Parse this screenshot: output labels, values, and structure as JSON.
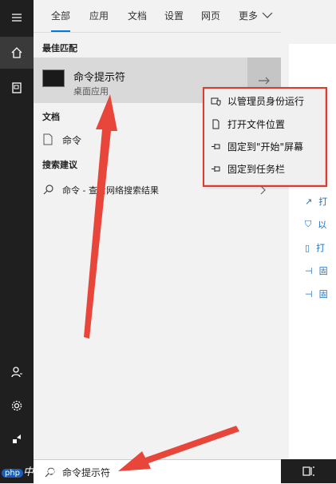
{
  "tabs": [
    "全部",
    "应用",
    "文档",
    "设置",
    "网页",
    "更多"
  ],
  "best_match": {
    "heading": "最佳匹配",
    "title": "命令提示符",
    "subtitle": "桌面应用"
  },
  "documents": {
    "heading": "文档",
    "item": "命令"
  },
  "search_suggestions": {
    "heading": "搜索建议",
    "item": "命令 - 查看网络搜索结果"
  },
  "context_menu": [
    {
      "label": "以管理员身份运行",
      "icon": "shield-icon"
    },
    {
      "label": "打开文件位置",
      "icon": "file-icon"
    },
    {
      "label": "固定到\"开始\"屏幕",
      "icon": "pin-icon"
    },
    {
      "label": "固定到任务栏",
      "icon": "pin-icon"
    }
  ],
  "right_actions": [
    "打",
    "以",
    "打",
    "固",
    "固"
  ],
  "search_box": {
    "value": "命令提示符"
  },
  "watermark": {
    "brand": "php",
    "text": "中文网"
  },
  "colors": {
    "accent": "#0078d7",
    "highlight_border": "#e03a2f",
    "arrow": "#e8463a"
  }
}
